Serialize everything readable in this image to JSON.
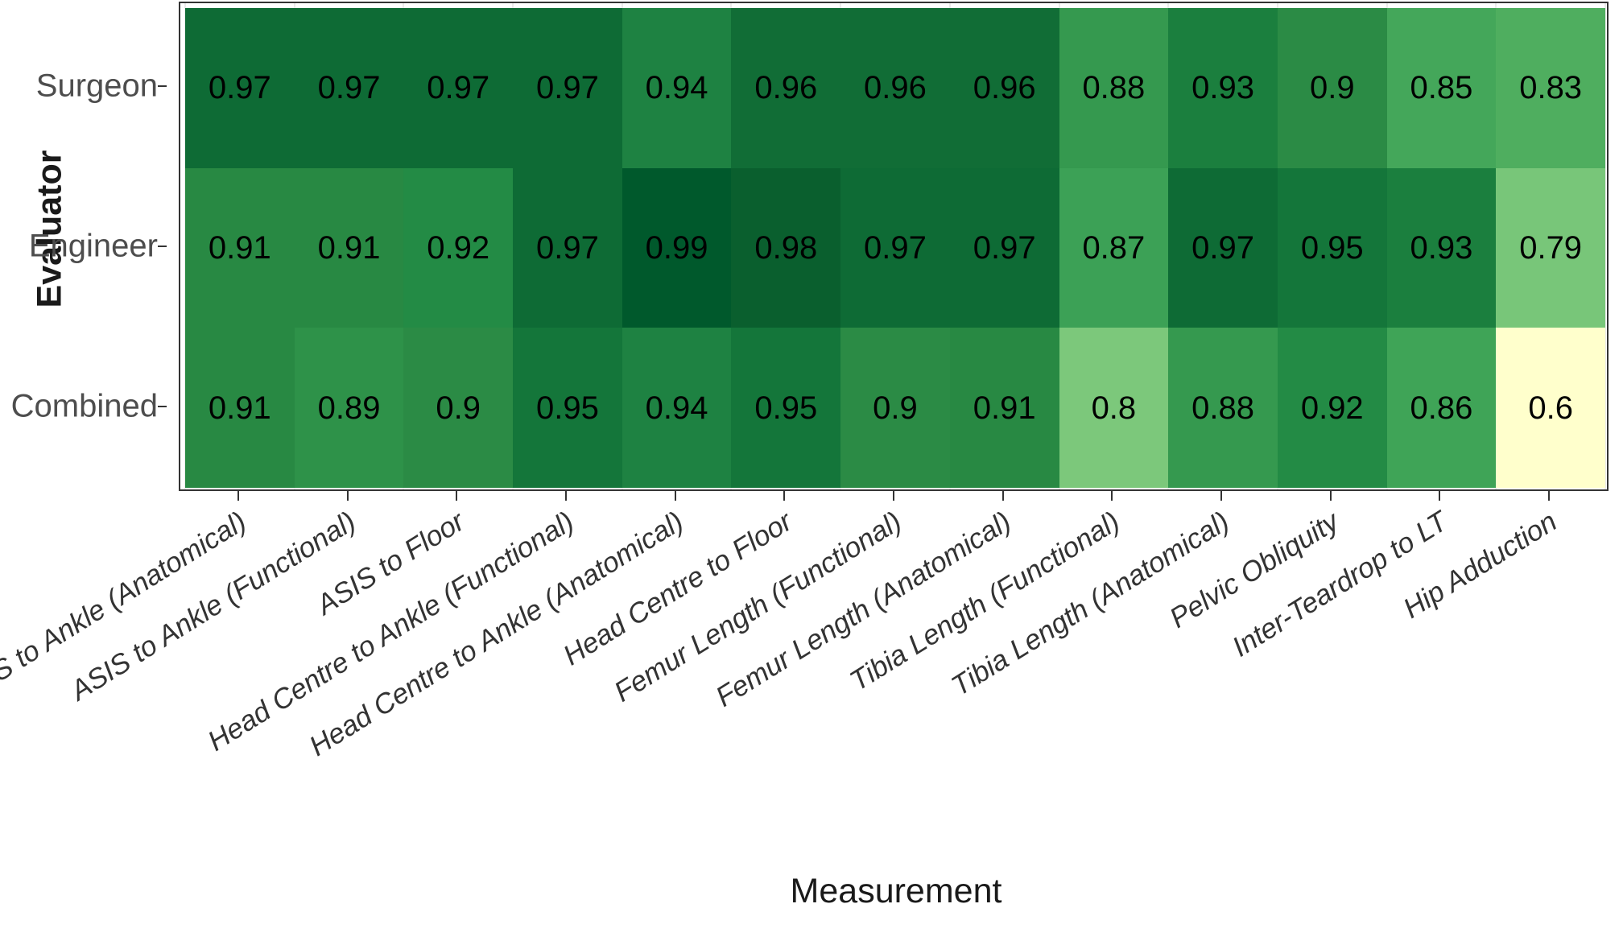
{
  "chart_data": {
    "type": "heatmap",
    "title": "",
    "xlabel": "Measurement",
    "ylabel": "Evaluator",
    "grid": true,
    "legend": "none",
    "colormap": "YlGn",
    "value_range": [
      0.6,
      0.99
    ],
    "categories": [
      "ASIS to Ankle (Anatomical)",
      "ASIS to Ankle (Functional)",
      "ASIS to Floor",
      "Head Centre to Ankle (Functional)",
      "Head Centre to Ankle (Anatomical)",
      "Head Centre to Floor",
      "Femur Length (Functional)",
      "Femur Length (Anatomical)",
      "Tibia Length (Functional)",
      "Tibia Length (Anatomical)",
      "Pelvic Obliquity",
      "Inter-Teardrop to LT",
      "Hip Adduction"
    ],
    "rows": [
      "Surgeon",
      "Engineer",
      "Combined"
    ],
    "series": [
      {
        "name": "Surgeon",
        "values": [
          0.97,
          0.97,
          0.97,
          0.97,
          0.94,
          0.96,
          0.96,
          0.96,
          0.88,
          0.93,
          0.9,
          0.85,
          0.83
        ],
        "labels": [
          "0.97",
          "0.97",
          "0.97",
          "0.97",
          "0.94",
          "0.96",
          "0.96",
          "0.96",
          "0.88",
          "0.93",
          "0.9",
          "0.85",
          "0.83"
        ]
      },
      {
        "name": "Engineer",
        "values": [
          0.91,
          0.91,
          0.92,
          0.97,
          0.99,
          0.98,
          0.97,
          0.97,
          0.87,
          0.97,
          0.95,
          0.93,
          0.79
        ],
        "labels": [
          "0.91",
          "0.91",
          "0.92",
          "0.97",
          "0.99",
          "0.98",
          "0.97",
          "0.97",
          "0.87",
          "0.97",
          "0.95",
          "0.93",
          "0.79"
        ]
      },
      {
        "name": "Combined",
        "values": [
          0.91,
          0.89,
          0.9,
          0.95,
          0.94,
          0.95,
          0.9,
          0.91,
          0.8,
          0.88,
          0.92,
          0.86,
          0.6
        ],
        "labels": [
          "0.91",
          "0.89",
          "0.9",
          "0.95",
          "0.94",
          "0.95",
          "0.9",
          "0.91",
          "0.8",
          "0.88",
          "0.92",
          "0.86",
          "0.6"
        ]
      }
    ],
    "color_stops": [
      {
        "v": 0.6,
        "hex": "#FFFFCC"
      },
      {
        "v": 0.79,
        "hex": "#78C679"
      },
      {
        "v": 0.8,
        "hex": "#7CC87B"
      },
      {
        "v": 0.83,
        "hex": "#4FAE5F"
      },
      {
        "v": 0.85,
        "hex": "#44A75A"
      },
      {
        "v": 0.86,
        "hex": "#3FA457"
      },
      {
        "v": 0.87,
        "hex": "#3CA156"
      },
      {
        "v": 0.88,
        "hex": "#35994F"
      },
      {
        "v": 0.89,
        "hex": "#2E9249"
      },
      {
        "v": 0.9,
        "hex": "#2B8B45"
      },
      {
        "v": 0.91,
        "hex": "#288943"
      },
      {
        "v": 0.92,
        "hex": "#238B45"
      },
      {
        "v": 0.93,
        "hex": "#1B7F3E"
      },
      {
        "v": 0.94,
        "hex": "#1E8242"
      },
      {
        "v": 0.95,
        "hex": "#14763A"
      },
      {
        "v": 0.96,
        "hex": "#116D36"
      },
      {
        "v": 0.97,
        "hex": "#0E6B35"
      },
      {
        "v": 0.98,
        "hex": "#0A5F2E"
      },
      {
        "v": 0.99,
        "hex": "#00592C"
      }
    ]
  },
  "axes": {
    "y_title": "Evaluator",
    "x_title": "Measurement"
  }
}
